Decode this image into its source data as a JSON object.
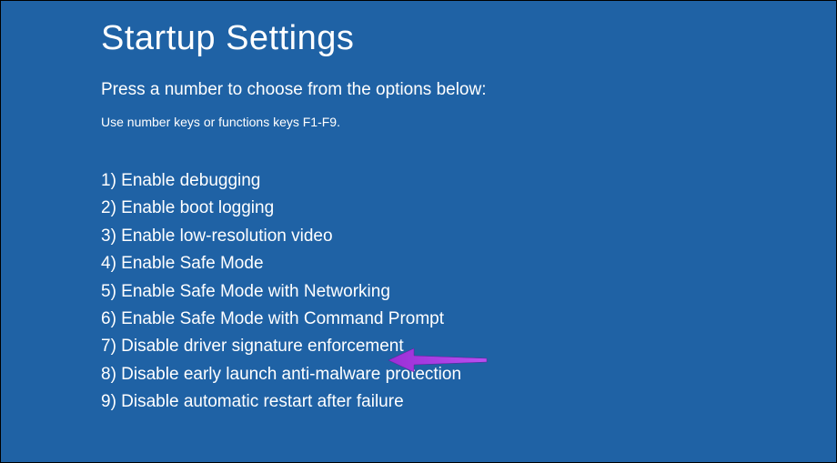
{
  "title": "Startup Settings",
  "subtitle": "Press a number to choose from the options below:",
  "instruction": "Use number keys or functions keys F1-F9.",
  "options": [
    "1) Enable debugging",
    "2) Enable boot logging",
    "3) Enable low-resolution video",
    "4) Enable Safe Mode",
    "5) Enable Safe Mode with Networking",
    "6) Enable Safe Mode with Command Prompt",
    "7) Disable driver signature enforcement",
    "8) Disable early launch anti-malware protection",
    "9) Disable automatic restart after failure"
  ],
  "annotation": {
    "arrow_color": "#9b2fd6",
    "arrow_target_index": 6
  }
}
